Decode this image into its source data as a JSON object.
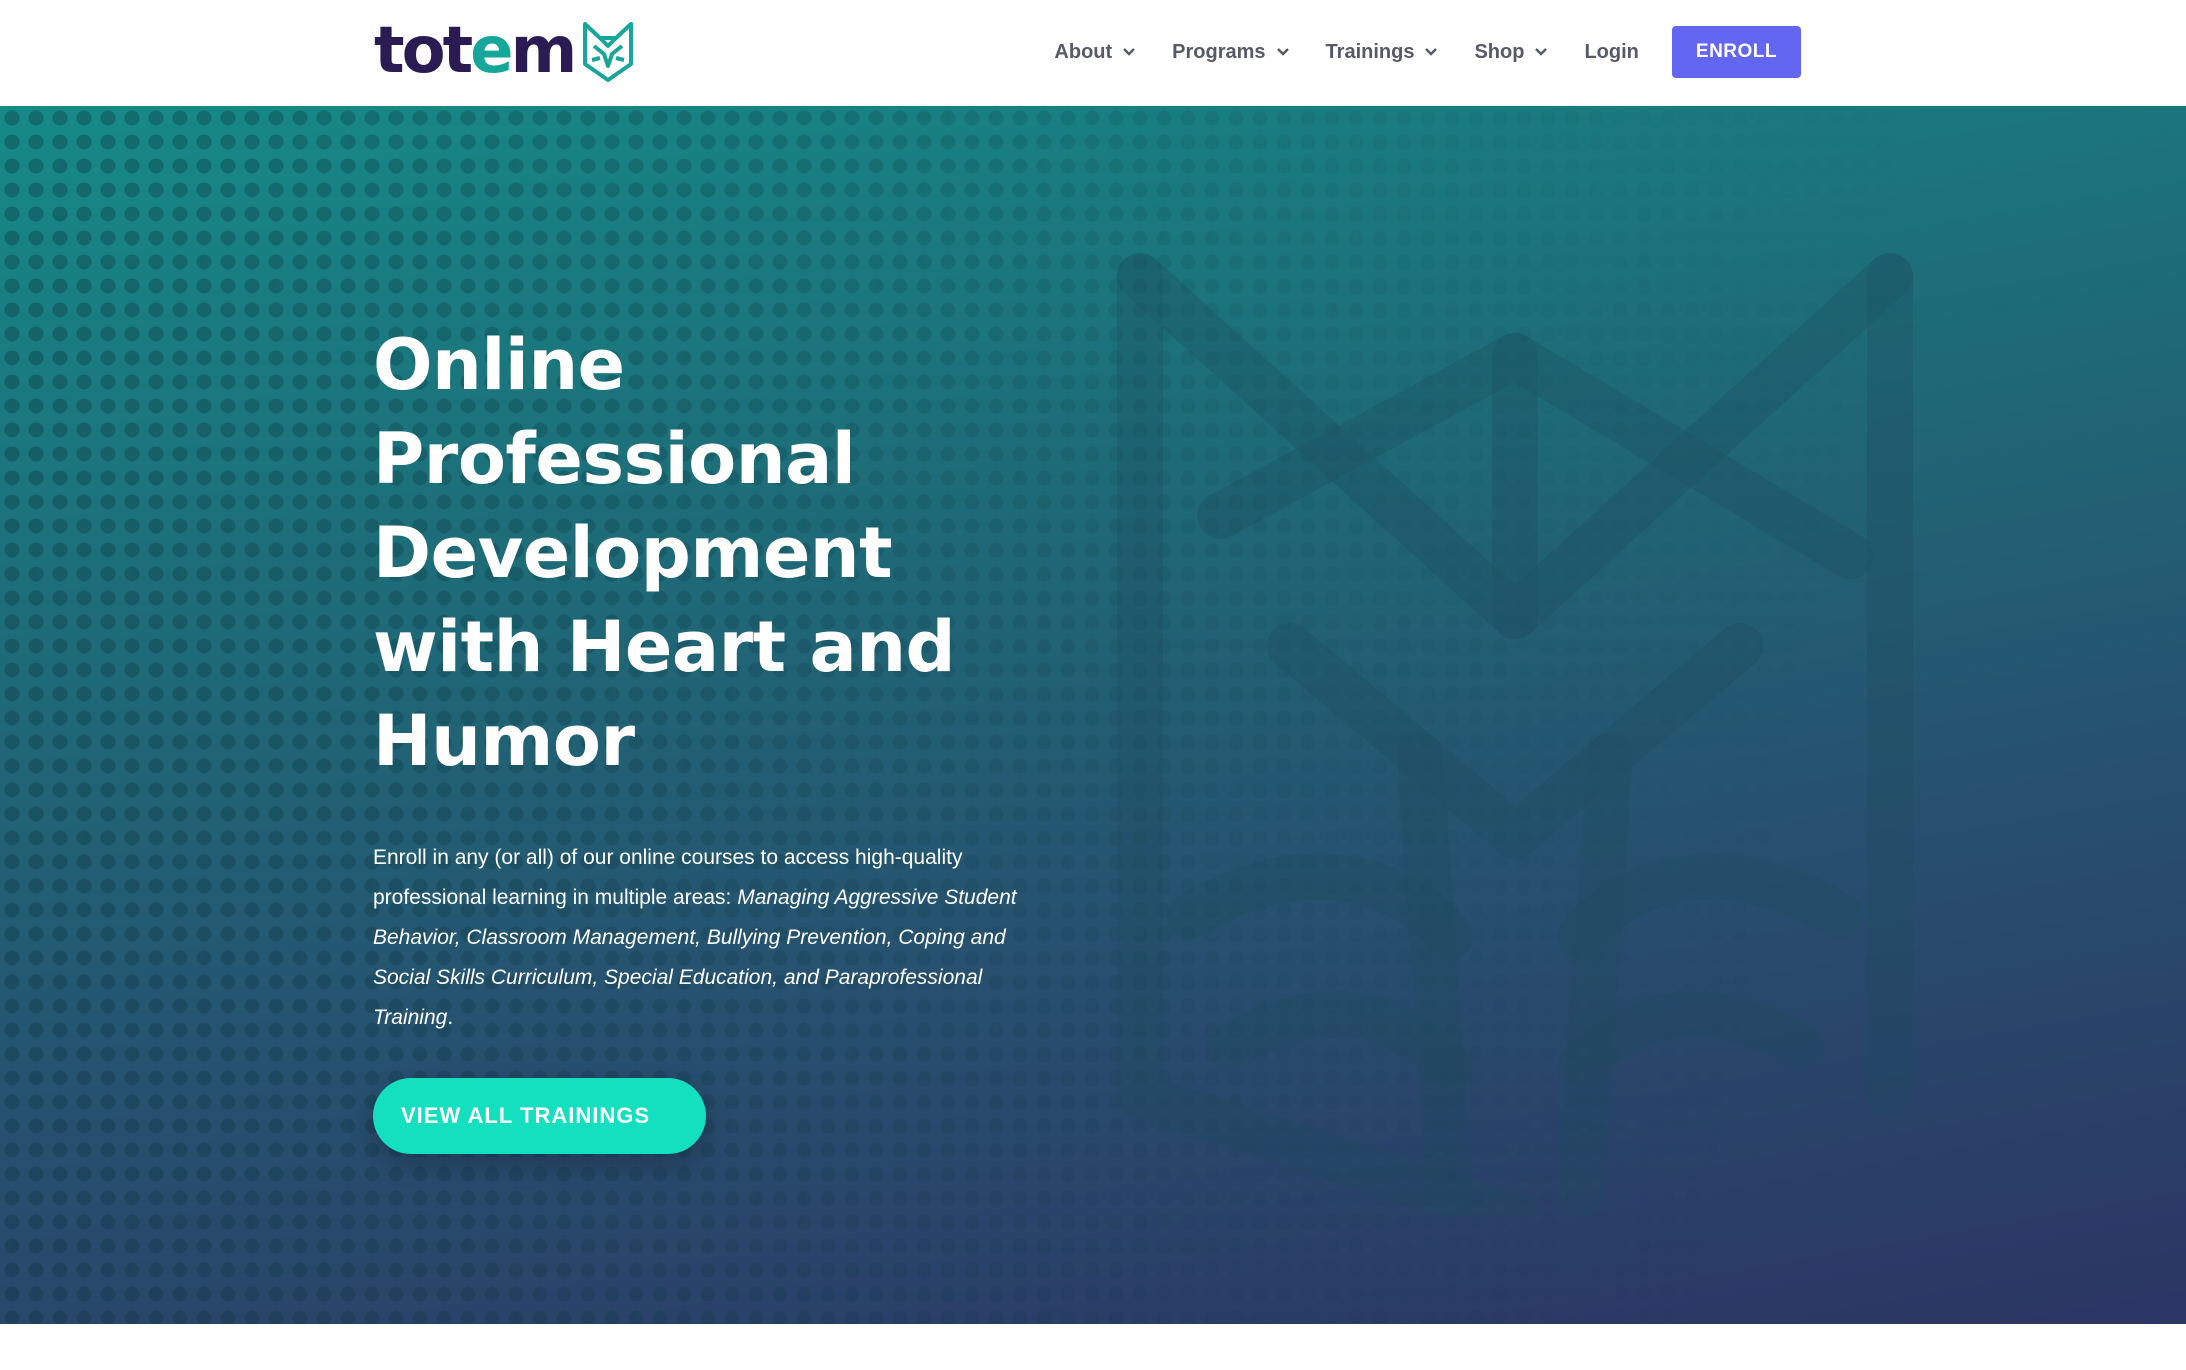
{
  "brand": {
    "logo_text_pre": "tot",
    "logo_text_e": "e",
    "logo_text_post": "m",
    "logo_icon": "fox-icon",
    "colors": {
      "primary_dark": "#2a1b52",
      "teal": "#17a69a"
    }
  },
  "nav": {
    "items": [
      {
        "label": "About",
        "has_dropdown": true
      },
      {
        "label": "Programs",
        "has_dropdown": true
      },
      {
        "label": "Trainings",
        "has_dropdown": true
      },
      {
        "label": "Shop",
        "has_dropdown": true
      }
    ],
    "login_label": "Login",
    "enroll_label": "ENROLL",
    "enroll_color": "#6366f1"
  },
  "hero": {
    "title_lines": [
      "Online",
      "Professional",
      "Development",
      "with Heart and",
      "Humor"
    ],
    "description_plain": "Enroll in any (or all) of our online courses to access high-quality professional learning in multiple areas: ",
    "description_italic": "Managing Aggressive Student Behavior, Classroom Management, Bullying Prevention, Coping and Social Skills Curriculum, Special Education, and Paraprofessional Training",
    "description_end": ".",
    "cta_label": "VIEW ALL TRAININGS",
    "cta_color": "#14e0c0",
    "gradient_colors": [
      "#168a87",
      "#2c3563"
    ]
  }
}
